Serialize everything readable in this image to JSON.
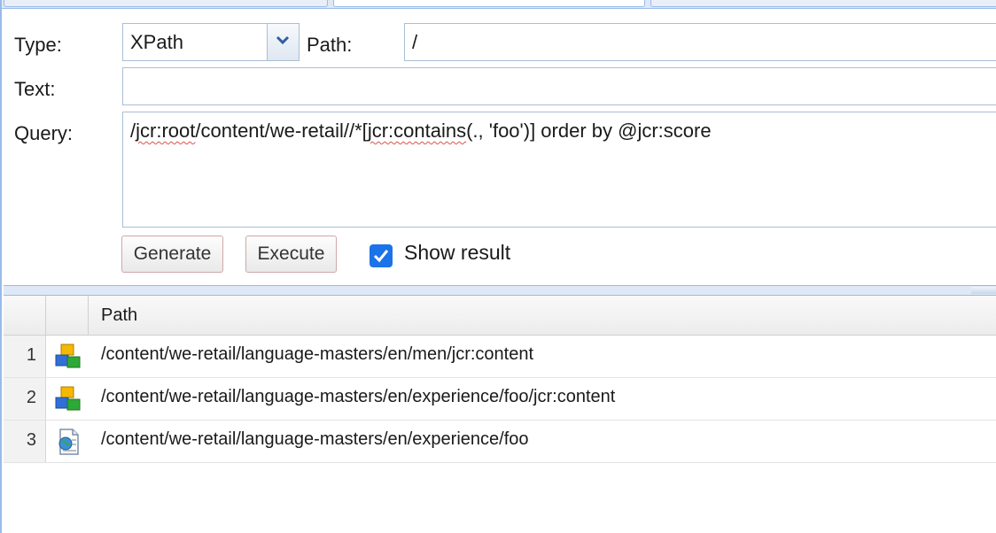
{
  "form": {
    "type_label": "Type:",
    "type_value": "XPath",
    "path_label": "Path:",
    "path_value": "/",
    "text_label": "Text:",
    "text_value": "",
    "query_label": "Query:",
    "query_parts": {
      "p1": "/",
      "p2": "jcr:root",
      "p3": "/content/we-retail//*[",
      "p4": "jcr:contains",
      "p5": "(., 'foo')] order by @jcr:score"
    }
  },
  "buttons": {
    "generate": "Generate",
    "execute": "Execute"
  },
  "show_result": {
    "label": "Show result",
    "checked": true
  },
  "grid": {
    "header": {
      "path": "Path"
    },
    "rows": [
      {
        "num": "1",
        "icon": "node-icon",
        "path": "/content/we-retail/language-masters/en/men/jcr:content"
      },
      {
        "num": "2",
        "icon": "node-icon",
        "path": "/content/we-retail/language-masters/en/experience/foo/jcr:content"
      },
      {
        "num": "3",
        "icon": "page-icon",
        "path": "/content/we-retail/language-masters/en/experience/foo"
      }
    ]
  },
  "colors": {
    "panel_border": "#99bbe8",
    "checkbox": "#1a73e8",
    "spellcheck": "#d9534f"
  }
}
